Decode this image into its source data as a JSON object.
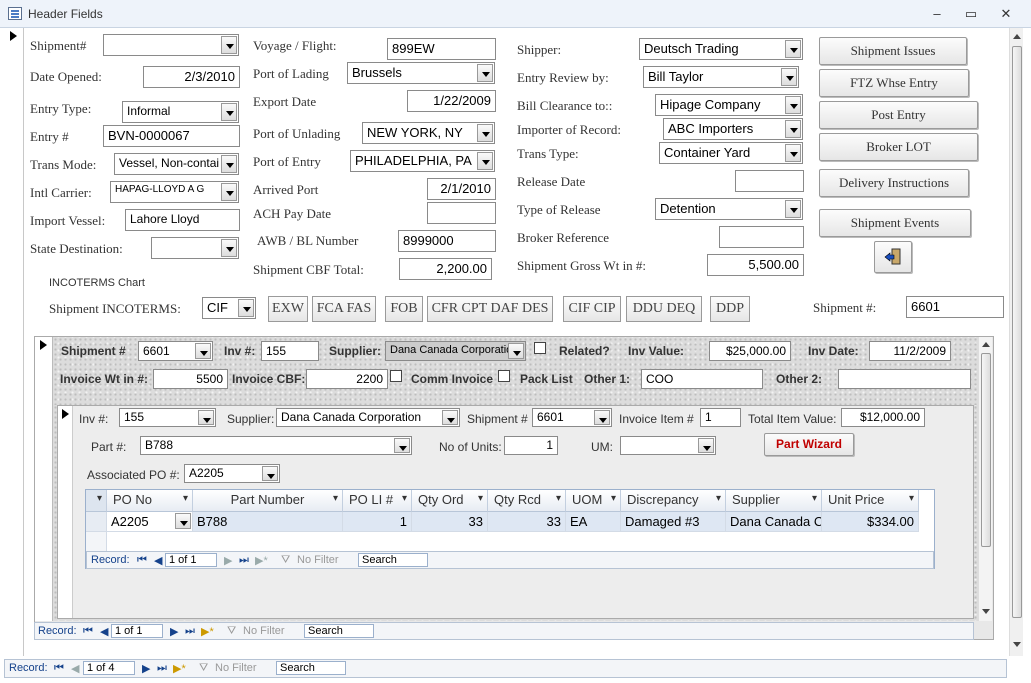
{
  "window": {
    "title": "Header Fields",
    "minimize": "–",
    "maximize": "▭",
    "close": "✕"
  },
  "header": {
    "shipment_no": {
      "label": "Shipment#",
      "value": ""
    },
    "date_opened": {
      "label": "Date Opened:",
      "value": "2/3/2010"
    },
    "entry_type": {
      "label": "Entry Type:",
      "value": "Informal"
    },
    "entry_no": {
      "label": "Entry #",
      "value": "BVN-0000067"
    },
    "trans_mode": {
      "label": "Trans Mode:",
      "value": "Vessel, Non-contai"
    },
    "intl_carrier": {
      "label": "Intl Carrier:",
      "value": "HAPAG-LLOYD A G"
    },
    "import_vessel": {
      "label": "Import Vessel:",
      "value": "Lahore Lloyd"
    },
    "state_destination": {
      "label": "State  Destination:",
      "value": ""
    },
    "voyage_flight": {
      "label": "Voyage / Flight:",
      "value": "899EW"
    },
    "port_of_lading": {
      "label": "Port of Lading",
      "value": "Brussels"
    },
    "export_date": {
      "label": "Export Date",
      "value": "1/22/2009"
    },
    "port_of_unlading": {
      "label": "Port of Unlading",
      "value": "NEW YORK, NY"
    },
    "port_of_entry": {
      "label": "Port of Entry",
      "value": "PHILADELPHIA, PA"
    },
    "arrived_port": {
      "label": "Arrived Port",
      "value": "2/1/2010"
    },
    "ach_pay_date": {
      "label": "ACH Pay Date",
      "value": ""
    },
    "awb_bl": {
      "label": "AWB / BL Number",
      "value": "8999000"
    },
    "shipment_cbf": {
      "label": "Shipment CBF Total:",
      "value": "2,200.00"
    },
    "shipper": {
      "label": "Shipper:",
      "value": "Deutsch Trading"
    },
    "entry_review": {
      "label": "Entry Review by:",
      "value": "Bill Taylor"
    },
    "bill_clearance": {
      "label": "Bill Clearance to::",
      "value": "Hipage Company"
    },
    "importer_of_record": {
      "label": "Importer of Record:",
      "value": "ABC Importers"
    },
    "trans_type": {
      "label": "Trans Type:",
      "value": "Container Yard"
    },
    "release_date": {
      "label": "Release Date",
      "value": ""
    },
    "type_of_release": {
      "label": "Type of Release",
      "value": "Detention"
    },
    "broker_reference": {
      "label": "Broker Reference",
      "value": ""
    },
    "gross_wt": {
      "label": "Shipment Gross Wt in #:",
      "value": "5,500.00"
    },
    "incoterms_chart": "INCOTERMS Chart",
    "incoterms": {
      "label": "Shipment INCOTERMS:",
      "value": "CIF"
    },
    "incoterm_buttons": [
      "EXW",
      "FCA FAS",
      "FOB",
      "CFR CPT DAF DES",
      "CIF CIP",
      "DDU DEQ",
      "DDP"
    ],
    "shipment_no_bottom": {
      "label": "Shipment #:",
      "value": "6601"
    }
  },
  "side_buttons": [
    "Shipment Issues",
    "FTZ Whse Entry",
    "Post Entry",
    "Broker LOT",
    "Delivery Instructions",
    "Shipment Events"
  ],
  "exit_icon": "exit-door-icon",
  "invoice": {
    "shipment_no": {
      "label": "Shipment #",
      "value": "6601"
    },
    "inv_no": {
      "label": "Inv #:",
      "value": "155"
    },
    "supplier": {
      "label": "Supplier:",
      "value": "Dana Canada Corporation"
    },
    "related": {
      "label": "Related?"
    },
    "inv_value": {
      "label": "Inv Value:",
      "value": "$25,000.00"
    },
    "inv_date": {
      "label": "Inv Date:",
      "value": "11/2/2009"
    },
    "invoice_wt": {
      "label": "Invoice Wt in #:",
      "value": "5500"
    },
    "invoice_cbf": {
      "label": "Invoice CBF:",
      "value": "2200"
    },
    "comm_invoice": {
      "label": "Comm Invoice"
    },
    "pack_list": {
      "label": "Pack List"
    },
    "other1": {
      "label": "Other 1:",
      "value": "COO"
    },
    "other2": {
      "label": "Other  2:",
      "value": ""
    }
  },
  "item": {
    "inv_no": {
      "label": "Inv #:",
      "value": "155"
    },
    "supplier": {
      "label": "Supplier:",
      "value": "Dana Canada Corporation"
    },
    "shipment_no": {
      "label": "Shipment #",
      "value": "6601"
    },
    "invoice_item_no": {
      "label": "Invoice Item #",
      "value": "1"
    },
    "total_item_value": {
      "label": "Total Item Value:",
      "value": "$12,000.00"
    },
    "part_no": {
      "label": "Part #:",
      "value": "B788"
    },
    "no_of_units": {
      "label": "No of Units:",
      "value": "1"
    },
    "um": {
      "label": "UM:",
      "value": ""
    },
    "part_wizard": "Part Wizard",
    "associated_po": {
      "label": "Associated PO #:",
      "value": "A2205"
    }
  },
  "po_grid": {
    "columns": [
      "PO No",
      "Part Number",
      "PO LI #",
      "Qty Ord",
      "Qty Rcd",
      "UOM",
      "Discrepancy",
      "Supplier",
      "Unit Price"
    ],
    "rows": [
      [
        "A2205",
        "B788",
        "1",
        "33",
        "33",
        "EA",
        "Damaged #3",
        "Dana Canada Co",
        "$334.00"
      ]
    ]
  },
  "nav": {
    "record_label": "Record:",
    "first": "⏮",
    "prev": "◀",
    "next": "▶",
    "last": "⏭",
    "new": "▶*",
    "no_filter": "No Filter",
    "search": "Search",
    "grid_pos": "1 of 1",
    "invoice_pos": "1 of 1",
    "main_pos": "1 of 4"
  },
  "colors": {
    "part_wizard": "#c00000",
    "nav_text": "#15428b"
  }
}
